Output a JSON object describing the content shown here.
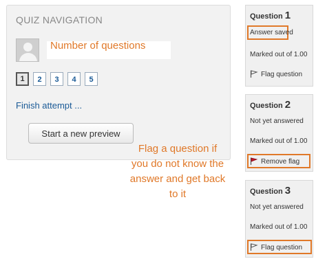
{
  "quiz_nav": {
    "title": "QUIZ NAVIGATION",
    "question_buttons": [
      "1",
      "2",
      "3",
      "4",
      "5"
    ],
    "current_question": "1",
    "finish_link": "Finish attempt ...",
    "preview_button": "Start a new preview"
  },
  "annotations": {
    "number_of_questions": "Number of questions",
    "flag_hint_lines": [
      "Flag a question if",
      "you do not know the",
      "answer and get back",
      "to it"
    ],
    "color": "#e07828"
  },
  "questions": [
    {
      "label": "Question",
      "number": "1",
      "status": "Answer saved",
      "marks": "Marked out of 1.00",
      "flag_action": "Flag question",
      "flagged": false
    },
    {
      "label": "Question",
      "number": "2",
      "status": "Not yet answered",
      "marks": "Marked out of 1.00",
      "flag_action": "Remove flag",
      "flagged": true
    },
    {
      "label": "Question",
      "number": "3",
      "status": "Not yet answered",
      "marks": "Marked out of 1.00",
      "flag_action": "Flag question",
      "flagged": false
    }
  ]
}
